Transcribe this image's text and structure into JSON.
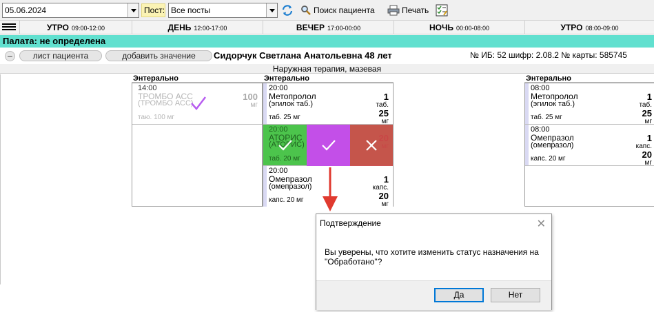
{
  "toolbar": {
    "date": "05.06.2024",
    "post_label": "Пост:",
    "post_value": "Все посты",
    "search_patient": "Поиск пациента",
    "print": "Печать"
  },
  "shifts": [
    {
      "name": "УТРО",
      "time": "09:00-12:00"
    },
    {
      "name": "ДЕНЬ",
      "time": "12:00-17:00"
    },
    {
      "name": "ВЕЧЕР",
      "time": "17:00-00:00"
    },
    {
      "name": "НОЧЬ",
      "time": "00:00-08:00"
    },
    {
      "name": "УТРО",
      "time": "08:00-09:00"
    }
  ],
  "ward": "Палата: не определена",
  "patient": {
    "minus": "–",
    "sheet_button": "лист пациента",
    "add_value_button": "добавить значение",
    "name": "Сидорчук Светлана Анатольевна 48 лет",
    "info": "№ ИБ: 52 шифр: 2.08.2 № карты: 585745"
  },
  "section_title": "Наружная терапия, мазевая",
  "columns": {
    "day_header": "Энтерально",
    "evening_header": "Энтерально",
    "morning_header": "Энтерально"
  },
  "cards": {
    "trombo": {
      "time": "14:00",
      "name": "ТРОМБО АСС",
      "sub": "(ТРОМБО АСС)",
      "form": "таю. 100 мг",
      "qty": "100",
      "unit": "мг"
    },
    "metoprolol_eve": {
      "time": "20:00",
      "name": "Метопролол",
      "sub": "(эгилок таб.)",
      "form": "таб. 25 мг",
      "qty": "1",
      "unit": "таб.",
      "dose": "25",
      "dose_unit": "мг"
    },
    "atoris": {
      "time": "20:00",
      "name": "АТОРИС",
      "sub": "(АТОРИС)",
      "form": "таб. 20 мг",
      "qty": "20",
      "unit": "мг"
    },
    "omeprazol_eve": {
      "time": "20:00",
      "name": "Омепразол",
      "sub": "(омепразол)",
      "form": "капс. 20 мг",
      "qty": "1",
      "unit": "капс.",
      "dose": "20",
      "dose_unit": "мг"
    },
    "metoprolol_morn": {
      "time": "08:00",
      "name": "Метопролол",
      "sub": "(эгилок таб.)",
      "form": "таб. 25 мг",
      "qty": "1",
      "unit": "таб.",
      "dose": "25",
      "dose_unit": "мг"
    },
    "omeprazol_morn": {
      "time": "08:00",
      "name": "Омепразол",
      "sub": "(омепразол)",
      "form": "капс. 20 мг",
      "qty": "1",
      "unit": "капс.",
      "dose": "20",
      "dose_unit": "мг"
    }
  },
  "colors": {
    "ward_bar": "#61e0cf",
    "status_green": "#4cc44c",
    "status_purple": "#c34fe8",
    "status_red": "#cf4b4b",
    "arrow_red": "#e03a2f"
  },
  "dialog": {
    "title": "Подтверждение",
    "message": "Вы уверены, что хотите изменить статус назначения на \"Обработано\"?",
    "yes": "Да",
    "no": "Нет"
  }
}
